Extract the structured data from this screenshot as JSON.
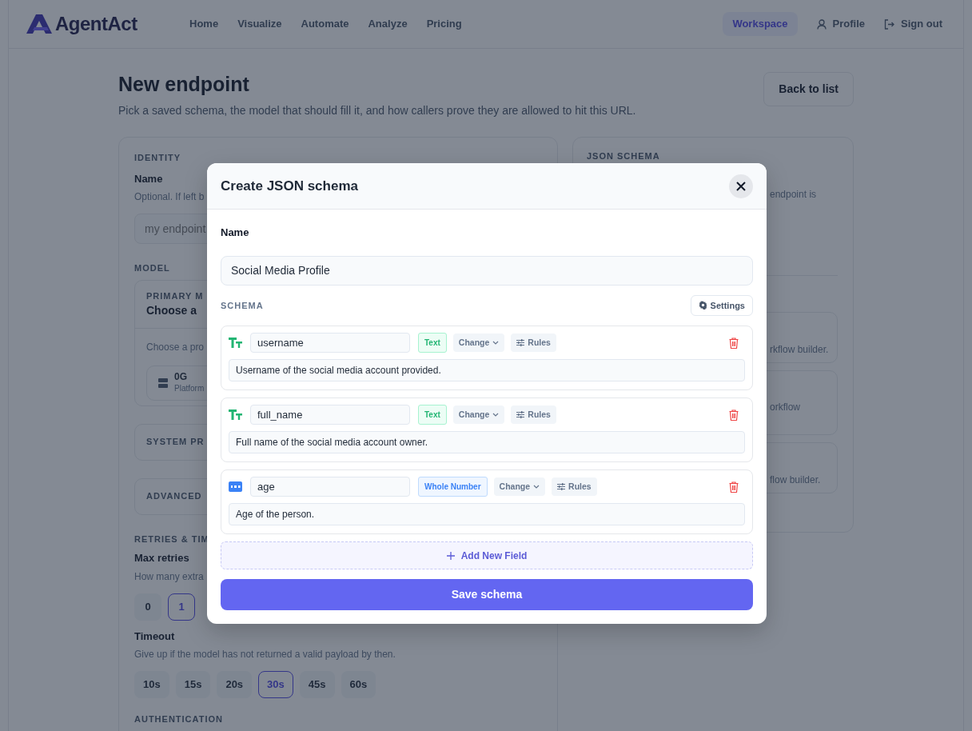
{
  "brand": {
    "text": "AgentAct"
  },
  "nav": {
    "links": [
      {
        "label": "Home"
      },
      {
        "label": "Visualize"
      },
      {
        "label": "Automate"
      },
      {
        "label": "Analyze"
      },
      {
        "label": "Pricing"
      }
    ],
    "right": [
      {
        "label": "Workspace",
        "kind": "pill",
        "selected": true
      },
      {
        "label": "Profile",
        "kind": "profile",
        "selected": false
      },
      {
        "label": "Sign out",
        "kind": "signout",
        "selected": false
      }
    ]
  },
  "page": {
    "title": "New endpoint",
    "subtitle": "Pick a saved schema, the model that should fill it, and how callers prove they are allowed to hit this URL.",
    "back_button": "Back to list"
  },
  "left_card": {
    "identity_heading": "IDENTITY",
    "name_label": "Name",
    "name_hint": "Optional. If left b",
    "name_placeholder": "my endpoint",
    "model_heading": "MODEL",
    "primary_label": "PRIMARY M",
    "primary_title": "Choose a",
    "provider_hint": "Choose a pro",
    "provider": {
      "name": "0G",
      "sub": "Platform"
    },
    "system_prompt": "SYSTEM PR",
    "advanced": "ADVANCED",
    "retries_heading": "RETRIES & TIM",
    "max_retries_label": "Max retries",
    "max_retries_hint": "How many extra",
    "retries": [
      {
        "label": "0",
        "selected": false
      },
      {
        "label": "1",
        "selected": true
      }
    ],
    "timeout_label": "Timeout",
    "timeout_hint": "Give up if the model has not returned a valid payload by then.",
    "timeouts": [
      {
        "label": "10s",
        "selected": false
      },
      {
        "label": "15s",
        "selected": false
      },
      {
        "label": "20s",
        "selected": false
      },
      {
        "label": "30s",
        "selected": true
      },
      {
        "label": "45s",
        "selected": false
      },
      {
        "label": "60s",
        "selected": false
      }
    ],
    "auth_heading": "AUTHENTICATION"
  },
  "right_card": {
    "heading": "JSON SCHEMA",
    "desc_tail": "endpoint is",
    "option_tails": [
      "rkflow builder.",
      "orkflow",
      "flow builder."
    ]
  },
  "modal": {
    "title": "Create JSON schema",
    "name_label": "Name",
    "name_value": "Social Media Profile",
    "schema_label": "SCHEMA",
    "settings_button": "Settings",
    "fields": [
      {
        "kind": "text",
        "name": "username",
        "type": "Text",
        "change_label": "Change",
        "rules_label": "Rules",
        "description": "Username of the social media account provided."
      },
      {
        "kind": "text",
        "name": "full_name",
        "type": "Text",
        "change_label": "Change",
        "rules_label": "Rules",
        "description": "Full name of the social media account owner."
      },
      {
        "kind": "number",
        "name": "age",
        "type": "Whole Number",
        "change_label": "Change",
        "rules_label": "Rules",
        "description": "Age of the person."
      }
    ],
    "add_field": "Add New Field",
    "save_button": "Save schema"
  }
}
